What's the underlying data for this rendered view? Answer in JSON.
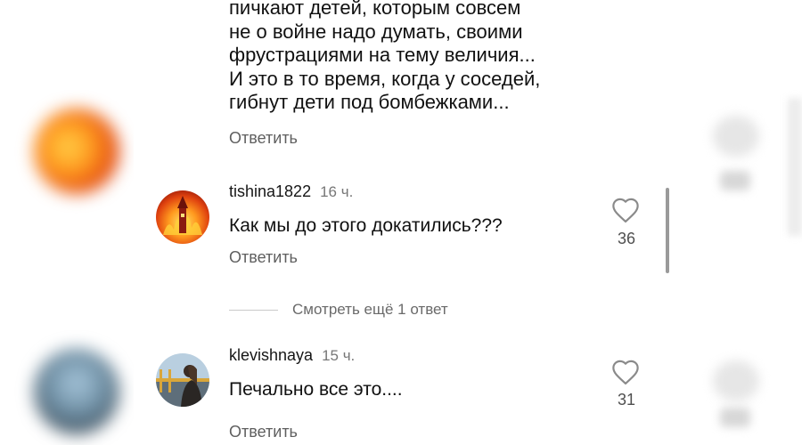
{
  "thread": {
    "previous_comment": {
      "text_lines": [
        "пичкают детей, которым совсем",
        "не о войне надо думать, своими",
        "фрустрациями на тему величия...",
        "И это в то время, когда у соседей,",
        "гибнут дети под бомбежками..."
      ],
      "reply_label": "Ответить"
    },
    "comments": [
      {
        "username": "tishina1822",
        "time": "16 ч.",
        "text": "Как мы до этого докатились???",
        "likes": "36",
        "reply_label": "Ответить"
      },
      {
        "username": "klevishnaya",
        "time": "15 ч.",
        "text": "Печально все это....",
        "likes": "31",
        "reply_label": "Ответить"
      }
    ],
    "view_more_replies": "Смотреть ещё 1 ответ"
  },
  "icons": {
    "like": "heart-outline-icon"
  },
  "colors": {
    "text": "#111111",
    "secondary_text": "#5f5f5f",
    "background": "#ffffff"
  }
}
